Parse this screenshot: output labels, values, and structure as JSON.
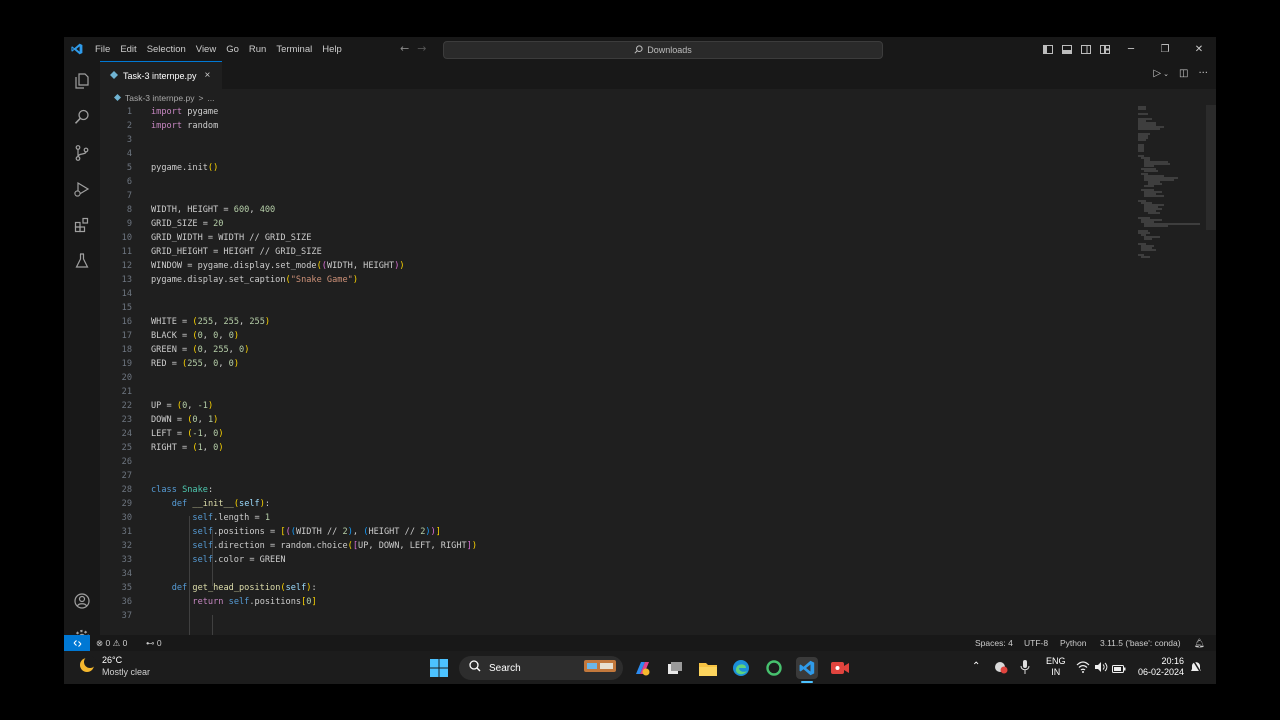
{
  "menu": {
    "items": [
      "File",
      "Edit",
      "Selection",
      "View",
      "Go",
      "Run",
      "Terminal",
      "Help"
    ]
  },
  "command_center": {
    "text": "Downloads"
  },
  "tab": {
    "label": "Task-3 internpe.py",
    "close": "×"
  },
  "breadcrumb": {
    "file": "Task-3 internpe.py",
    "sep": ">",
    "more": "..."
  },
  "code": {
    "l1": "1",
    "l2": "2",
    "l3": "3",
    "l4": "4",
    "l5": "5",
    "l6": "6",
    "l7": "7",
    "l8": "8",
    "l9": "9",
    "l10": "10",
    "l11": "11",
    "l12": "12",
    "l13": "13",
    "l14": "14",
    "l15": "15",
    "l16": "16",
    "l17": "17",
    "l18": "18",
    "l19": "19",
    "l20": "20",
    "l21": "21",
    "l22": "22",
    "l23": "23",
    "l24": "24",
    "l25": "25",
    "l26": "26",
    "l27": "27",
    "l28": "28",
    "l29": "29",
    "l30": "30",
    "l31": "31",
    "l32": "32",
    "l33": "33",
    "l34": "34",
    "l35": "35",
    "l36": "36",
    "l37": "37",
    "import_kw": "import",
    "mod_pygame": "pygame",
    "mod_random": "random",
    "init_call": "pygame.init",
    "dims_lhs": "WIDTH, HEIGHT = ",
    "n600": "600",
    "n400": "400",
    "n20": "20",
    "n255": "255",
    "n0": "0",
    "n1": "1",
    "nm1": "-1",
    "n2": "2",
    "grid_size_lhs": "GRID_SIZE = ",
    "grid_width_line": "GRID_WIDTH = WIDTH // GRID_SIZE",
    "grid_height_line": "GRID_HEIGHT = HEIGHT // GRID_SIZE",
    "window_lhs": "WINDOW = pygame.display.set_mode",
    "window_args": "WIDTH, HEIGHT",
    "caption_call": "pygame.display.set_caption",
    "caption_str": "\"Snake Game\"",
    "white_lhs": "WHITE = ",
    "black_lhs": "BLACK = ",
    "green_lhs": "GREEN = ",
    "red_lhs": "RED = ",
    "up_lhs": "UP = ",
    "down_lhs": "DOWN = ",
    "left_lhs": "LEFT = ",
    "right_lhs": "RIGHT = ",
    "class_kw": "class",
    "class_name": "Snake",
    "def_kw": "def",
    "init_fn": "__init__",
    "self": "self",
    "length_attr": ".length = ",
    "positions_attr": ".positions = ",
    "positions_expr_a": "WIDTH // ",
    "positions_expr_b": "HEIGHT // ",
    "direction_attr": ".direction = random.choice",
    "direction_args": "UP, DOWN, LEFT, RIGHT",
    "color_attr": ".color = GREEN",
    "get_head_fn": "get_head_position",
    "return_kw": "return",
    "return_expr": ".positions",
    "idx0": "0"
  },
  "status": {
    "errors": "0",
    "warnings": "0",
    "ports": "0",
    "spaces": "Spaces: 4",
    "encoding": "UTF-8",
    "language": "Python",
    "interpreter": "3.11.5 ('base': conda)"
  },
  "taskbar": {
    "temp": "26°C",
    "weather": "Mostly clear",
    "search": "Search",
    "lang1": "ENG",
    "lang2": "IN",
    "time": "20:16",
    "date": "06-02-2024"
  },
  "colors": {
    "accent": "#0078d4",
    "editor_bg": "#1f1f1f",
    "chrome_bg": "#181818"
  }
}
